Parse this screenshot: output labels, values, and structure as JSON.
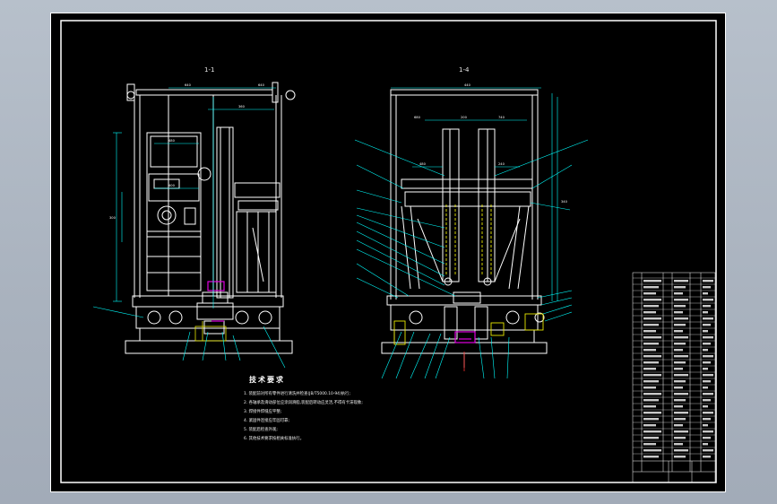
{
  "drawing": {
    "view_left_label": "1-1",
    "view_right_label": "1-4",
    "tech_requirements": {
      "title": "技术要求",
      "items": [
        "1. 装配前对所有零件进行清洗并检查(JB/T5000.10-94)执行;",
        "2. 各轴承及滑动部位应涂润滑脂,装配后转动应灵活,不得有卡滞现象;",
        "3. 焊接件焊缝应平整;",
        "4. 紧固件连接应牢固可靠;",
        "5. 装配后检查外观;",
        "6. 其他技术要求按相关标准执行。"
      ]
    },
    "dims_left": [
      "640",
      "640",
      "360",
      "480",
      "400",
      "300"
    ],
    "dims_right": [
      "680",
      "200",
      "740",
      "480",
      "240",
      "440",
      "340"
    ]
  },
  "colors": {
    "sheet_bg": "#000000",
    "border": "#ffffff",
    "geometry": "#ffffff",
    "dimension": "#00ffff",
    "hidden": "#e8e800",
    "accent": "#e000e0",
    "leader": "#ff3030"
  }
}
